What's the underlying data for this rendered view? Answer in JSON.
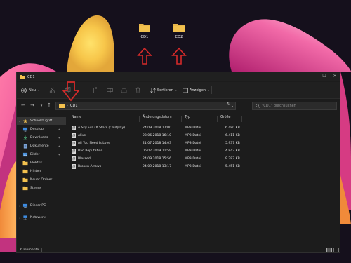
{
  "colors": {
    "accent_red": "#d42a2a",
    "folder_yellow": "#f2c14e",
    "window_bg": "#1c1c1c",
    "wallpaper_pink": "#e8509a"
  },
  "desktop": {
    "icons": [
      {
        "label": "CD1",
        "icon": "folder-icon"
      },
      {
        "label": "CD2",
        "icon": "folder-icon"
      }
    ]
  },
  "window": {
    "title": "CD1",
    "controls": {
      "minimize": "—",
      "maximize": "☐",
      "close": "✕"
    }
  },
  "toolbar": {
    "new_label": "Neu",
    "sort_label": "Sortieren",
    "view_label": "Anzeigen",
    "more_label": "···",
    "icons": [
      "cut-icon",
      "copy-icon",
      "paste-icon",
      "rename-icon",
      "share-icon",
      "delete-icon"
    ]
  },
  "address": {
    "crumb": "CD1",
    "search_placeholder": "\"CD1\" durchsuchen"
  },
  "nav": {
    "items": [
      {
        "label": "Schnellzugriff",
        "icon": "star-icon",
        "pinned": false
      },
      {
        "label": "Desktop",
        "icon": "desktop-icon",
        "pinned": true
      },
      {
        "label": "Downloads",
        "icon": "download-icon",
        "pinned": true
      },
      {
        "label": "Dokumente",
        "icon": "documents-icon",
        "pinned": true
      },
      {
        "label": "Bilder",
        "icon": "pictures-icon",
        "pinned": true
      },
      {
        "label": "Elektrik",
        "icon": "folder-icon",
        "pinned": false
      },
      {
        "label": "Hinten",
        "icon": "folder-icon",
        "pinned": false
      },
      {
        "label": "Neuer Ordner",
        "icon": "folder-icon",
        "pinned": false
      },
      {
        "label": "Sterne",
        "icon": "folder-icon",
        "pinned": false
      },
      {
        "label": "Dieser PC",
        "icon": "pc-icon",
        "pinned": false
      },
      {
        "label": "Netzwerk",
        "icon": "network-icon",
        "pinned": false
      }
    ]
  },
  "files": {
    "columns": {
      "name": "Name",
      "date": "Änderungsdatum",
      "type": "Typ",
      "size": "Größe"
    },
    "rows": [
      {
        "name": "A Sky Full Of Stars (Coldplay)",
        "date": "24.09.2018 17:00",
        "type": "MP3-Datei",
        "size": "6.480 KB"
      },
      {
        "name": "Alive",
        "date": "23.06.2018 16:10",
        "type": "MP3-Datei",
        "size": "6.411 KB"
      },
      {
        "name": "All You Need Is Love",
        "date": "21.07.2018 14:03",
        "type": "MP3-Datei",
        "size": "5.937 KB"
      },
      {
        "name": "Bad Reputation",
        "date": "06.07.2019 11:59",
        "type": "MP3-Datei",
        "size": "4.842 KB"
      },
      {
        "name": "Blessed",
        "date": "24.09.2018 15:56",
        "type": "MP3-Datei",
        "size": "9.287 KB"
      },
      {
        "name": "Broken Arrows",
        "date": "24.09.2018 13:17",
        "type": "MP3-Datei",
        "size": "5.451 KB"
      }
    ]
  },
  "status": {
    "count_text": "6 Elemente"
  }
}
